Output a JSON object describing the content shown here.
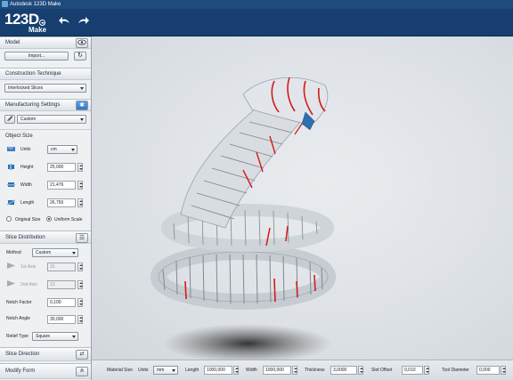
{
  "window": {
    "title": "Autodesk 123D Make"
  },
  "header": {
    "logo_main": "123D",
    "logo_sub": "Make",
    "undo_icon": "undo-arrow-icon",
    "redo_icon": "redo-arrow-icon"
  },
  "model": {
    "title": "Model",
    "import_label": "Import..."
  },
  "construction": {
    "title": "Construction Technique",
    "technique": "Interlocked Slices"
  },
  "manufacturing": {
    "title": "Manufacturing Settings",
    "preset": "Custom"
  },
  "object_size": {
    "title": "Object Size",
    "units_label": "Units",
    "units_value": "cm",
    "height_label": "Height",
    "height_value": "25,000",
    "width_label": "Width",
    "width_value": "21,476",
    "length_label": "Length",
    "length_value": "26,750",
    "original_size_label": "Original Size",
    "uniform_scale_label": "Uniform Scale",
    "selected_option": "Uniform Scale"
  },
  "slice_distribution": {
    "title": "Slice Distribution",
    "method_label": "Method",
    "method_value": "Custom",
    "axis1_label": "1st Axis",
    "axis1_value": "15",
    "axis2_label": "2nd Axis",
    "axis2_value": "13",
    "notch_factor_label": "Notch Factor",
    "notch_factor_value": "0,100",
    "notch_angle_label": "Notch Angle",
    "notch_angle_value": "30,000",
    "relief_type_label": "Relief Type",
    "relief_type_value": "Square"
  },
  "slice_direction": {
    "title": "Slice Direction"
  },
  "modify_form": {
    "title": "Modify Form"
  },
  "material": {
    "material_size_label": "Material Size",
    "units_label": "Units",
    "units_value": "mm",
    "length_label": "Length",
    "length_value": "1000,000",
    "width_label": "Width",
    "width_value": "1000,000",
    "thickness_label": "Thickness",
    "thickness_value": "3,0000",
    "slot_offset_label": "Slot Offset",
    "slot_offset_value": "0,010",
    "tool_diameter_label": "Tool Diameter",
    "tool_diameter_value": "0,000"
  },
  "colors": {
    "header": "#163f70",
    "accent": "#d21a1a"
  }
}
